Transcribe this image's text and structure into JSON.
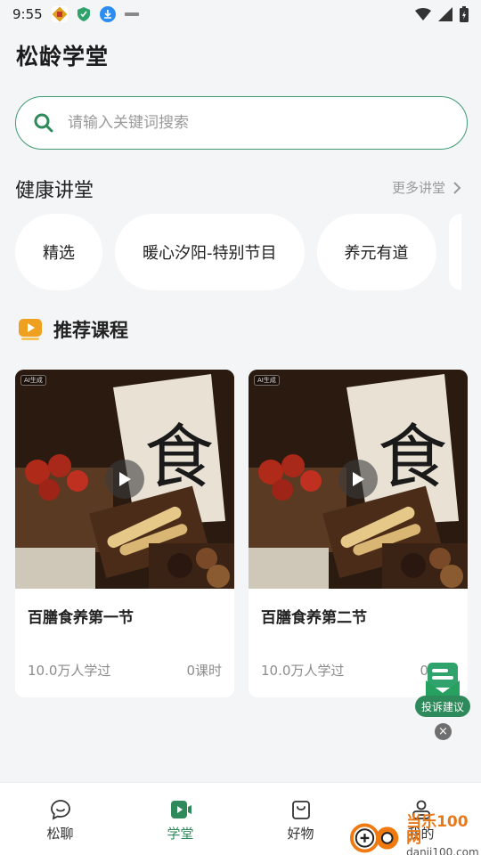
{
  "status_bar": {
    "time": "9:55"
  },
  "page": {
    "title": "松龄学堂"
  },
  "search": {
    "placeholder": "请输入关键词搜索"
  },
  "lectures": {
    "title": "健康讲堂",
    "more_label": "更多讲堂",
    "chips": [
      "精选",
      "暖心汐阳-特别节目",
      "养元有道"
    ]
  },
  "recommended": {
    "title": "推荐课程",
    "courses": [
      {
        "ai_tag": "AI生成",
        "thumb_char": "食",
        "name": "百膳食养第一节",
        "learners": "10.0万人学过",
        "lessons": "0课时"
      },
      {
        "ai_tag": "AI生成",
        "thumb_char": "食",
        "name": "百膳食养第二节",
        "learners": "10.0万人学过",
        "lessons": "0课时"
      }
    ]
  },
  "complaint": {
    "label": "投诉建议",
    "close_symbol": "×"
  },
  "tabs": [
    {
      "label": "松聊",
      "icon": "chat-icon"
    },
    {
      "label": "学堂",
      "icon": "video-play-icon"
    },
    {
      "label": "好物",
      "icon": "shopping-bag-icon"
    },
    {
      "label": "我的",
      "icon": "profile-icon"
    }
  ],
  "watermark": {
    "brand": "当乐100网",
    "url": "danji100.com"
  },
  "colors": {
    "accent": "#2f8a5b",
    "search_border": "#3f9a72",
    "background": "#f4f5f7",
    "rec_icon": "#f0a020"
  }
}
